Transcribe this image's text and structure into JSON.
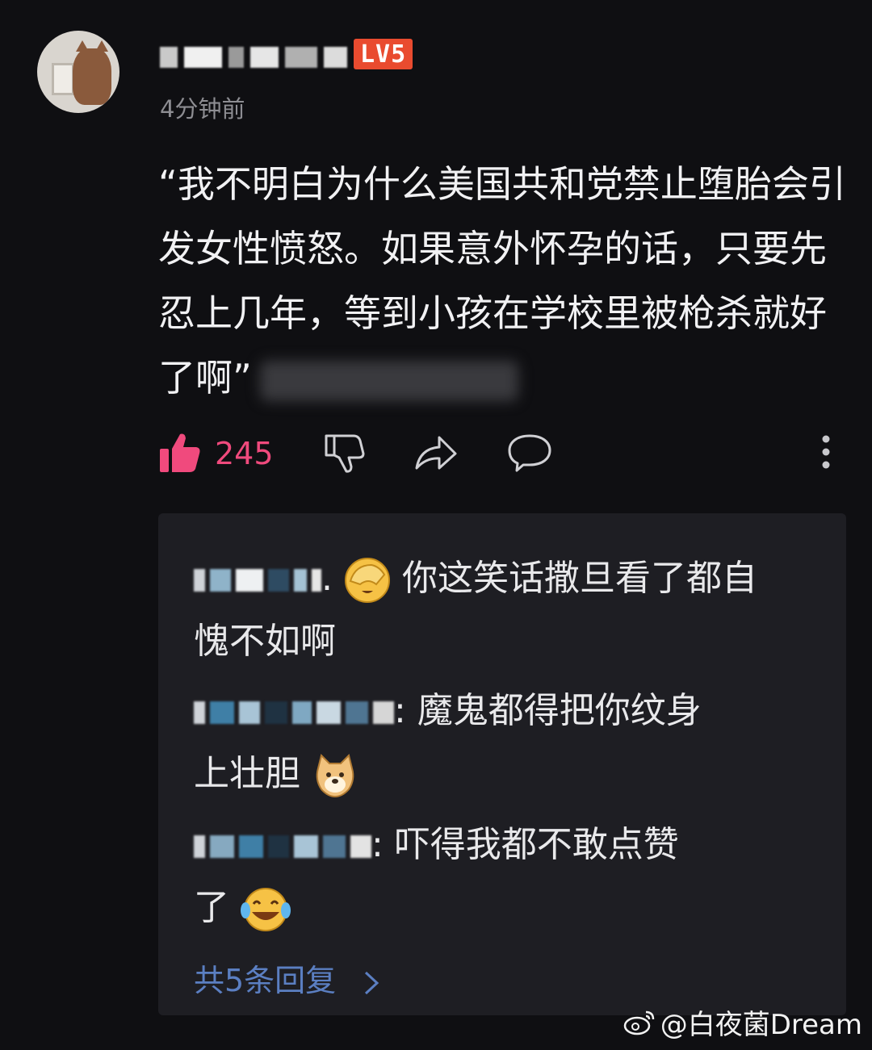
{
  "post": {
    "level_badge": "LV5",
    "time": "4分钟前",
    "text": "“我不明白为什么美国共和党禁止堕胎会引发女性愤怒。如果意外怀孕的话，只要先忍上几年，等到小孩在学校里被枪杀就好了啊”",
    "like_count": "245"
  },
  "replies": [
    {
      "sep": ".",
      "text_a": "你这笑话撒旦看了都自",
      "text_b": "愧不如啊",
      "emoji": "facepalm-emoji"
    },
    {
      "sep": ": ",
      "text_a": "魔鬼都得把你纹身",
      "text_b": "上壮胆",
      "emoji": "doge-emoji"
    },
    {
      "sep": ": ",
      "text_a": "吓得我都不敢点赞",
      "text_b": "了",
      "emoji": "laugh-cry-emoji"
    }
  ],
  "more_replies": "共5条回复",
  "watermark": "@白夜菌Dream",
  "colors": {
    "like": "#f04a7d",
    "link": "#5b7fc2",
    "badge": "#e94b2f"
  }
}
